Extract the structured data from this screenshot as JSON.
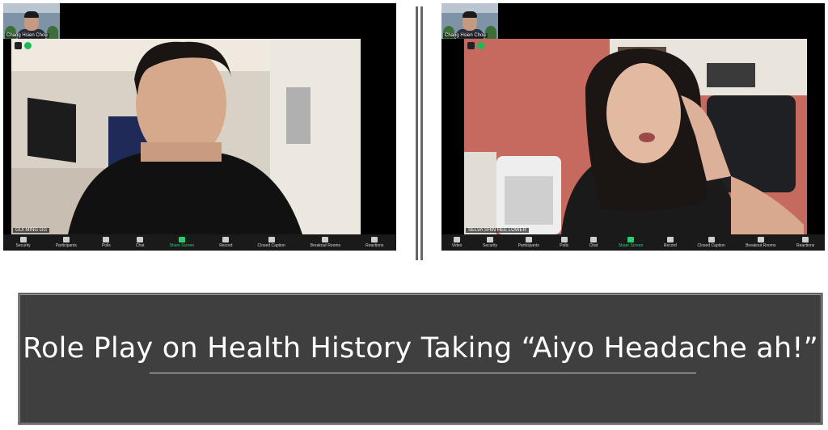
{
  "left_window": {
    "thumbnail_name": "Chang Hsien Chou",
    "video_label": "GUI MING GG",
    "toolbar": [
      "Security",
      "Participants",
      "Polls",
      "Chat",
      "Share Screen",
      "Record",
      "Closed Caption",
      "Breakout Rooms",
      "Reactions"
    ]
  },
  "right_window": {
    "thumbnail_name": "Chang Hsien Chou",
    "video_label": "SELVA SHIN HEE LOWER",
    "toolbar": [
      "Video",
      "Security",
      "Participants",
      "Polls",
      "Chat",
      "Share Screen",
      "Record",
      "Closed Caption",
      "Breakout Rooms",
      "Reactions"
    ]
  },
  "banner": {
    "title": "Role Play on Health History Taking “Aiyo Headache ah!”"
  }
}
